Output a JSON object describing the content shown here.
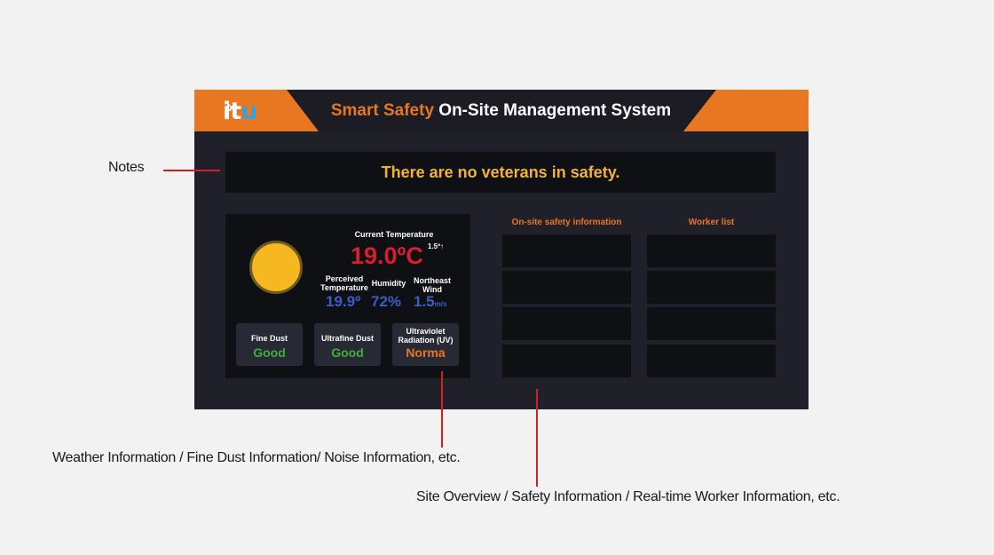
{
  "header": {
    "logo_text_i": "it",
    "logo_text_u": "u",
    "title_accent": "Smart Safety",
    "title_rest": "On-Site Management System"
  },
  "notice": {
    "text": "There are no veterans in safety."
  },
  "weather": {
    "current_temp_label": "Current Temperature",
    "current_temp": "19.0ºC",
    "temp_delta": "1.5º↑",
    "perceived_label": "Perceived Temperature",
    "perceived_value": "19.9º",
    "humidity_label": "Humidity",
    "humidity_value": "72%",
    "wind_label": "Northeast Wind",
    "wind_value": "1.5",
    "wind_unit": "m/s"
  },
  "air_quality": [
    {
      "label": "Fine Dust",
      "value": "Good"
    },
    {
      "label": "Ultrafine Dust",
      "value": "Good"
    },
    {
      "label": "Ultraviolet Radiation (UV)",
      "value": "Norma"
    }
  ],
  "panels": {
    "safety_title": "On-site safety information",
    "worker_title": "Worker list"
  },
  "annotations": {
    "notes": "Notes",
    "weather": "Weather Information / Fine Dust Information/ Noise Information, etc.",
    "site": "Site Overview / Safety Information / Real-time Worker Information, etc."
  },
  "colors": {
    "accent_orange": "#e87722",
    "temp_red": "#d81e2a",
    "value_blue": "#3a5fc8",
    "good_green": "#3fae3a",
    "notice_yellow": "#f2b233"
  }
}
